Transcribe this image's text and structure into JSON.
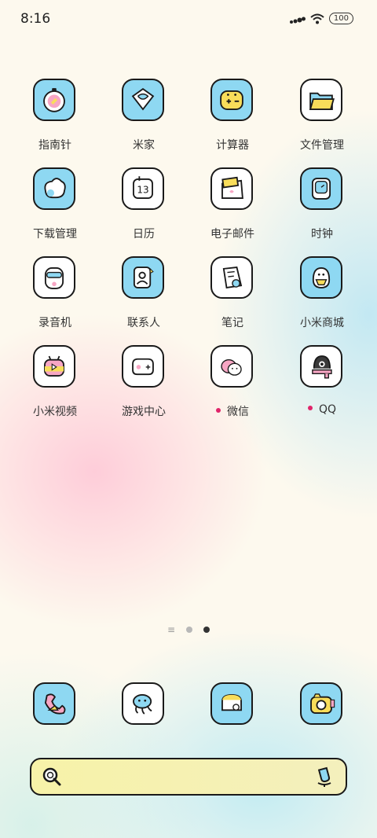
{
  "status_bar": {
    "time": "8:16",
    "battery": "100",
    "icons": [
      "signal-icon",
      "wifi-icon",
      "battery-icon"
    ]
  },
  "apps": [
    {
      "label": "指南针",
      "icon": "compass-icon",
      "dot": false
    },
    {
      "label": "米家",
      "icon": "mijia-icon",
      "dot": false
    },
    {
      "label": "计算器",
      "icon": "calculator-icon",
      "dot": false
    },
    {
      "label": "文件管理",
      "icon": "folder-icon",
      "dot": false
    },
    {
      "label": "下载管理",
      "icon": "download-icon",
      "dot": false
    },
    {
      "label": "日历",
      "icon": "calendar-icon",
      "dot": false
    },
    {
      "label": "电子邮件",
      "icon": "mail-icon",
      "dot": false
    },
    {
      "label": "时钟",
      "icon": "clock-icon",
      "dot": false
    },
    {
      "label": "录音机",
      "icon": "recorder-icon",
      "dot": false
    },
    {
      "label": "联系人",
      "icon": "contacts-icon",
      "dot": false
    },
    {
      "label": "笔记",
      "icon": "notes-icon",
      "dot": false
    },
    {
      "label": "小米商城",
      "icon": "mi-store-icon",
      "dot": false
    },
    {
      "label": "小米视频",
      "icon": "mi-video-icon",
      "dot": false
    },
    {
      "label": "游戏中心",
      "icon": "game-center-icon",
      "dot": false
    },
    {
      "label": "微信",
      "icon": "wechat-icon",
      "dot": true
    },
    {
      "label": "QQ",
      "icon": "qq-icon",
      "dot": true
    }
  ],
  "calendar_day": "13",
  "dock": [
    {
      "icon": "phone-icon"
    },
    {
      "icon": "messages-icon"
    },
    {
      "icon": "browser-icon"
    },
    {
      "icon": "camera-icon"
    }
  ],
  "pager": {
    "pages": 2,
    "active": 2
  },
  "search": {
    "icons": [
      "search-icon",
      "voice-icon"
    ]
  },
  "colors": {
    "icon_blue": "#8ed8f2",
    "icon_white": "#ffffff",
    "accent_yellow": "#f8dd5a",
    "accent_pink": "#f7a6c4",
    "notify_dot": "#e0246a"
  }
}
